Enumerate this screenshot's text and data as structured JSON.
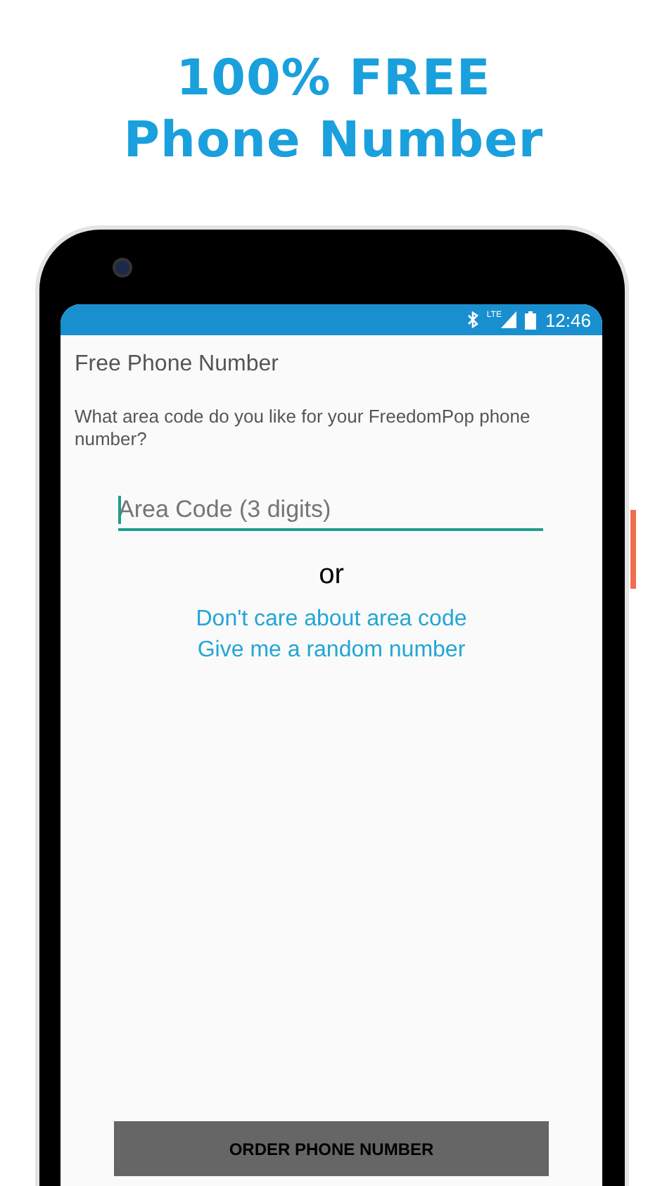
{
  "headline": [
    "100% FREE",
    "Phone Number"
  ],
  "status_bar": {
    "network": "LTE",
    "time": "12:46"
  },
  "screen": {
    "title": "Free Phone Number",
    "question": "What area code do you like for your FreedomPop phone number?",
    "area_code_field": {
      "placeholder": "Area Code (3 digits)",
      "focused": true
    },
    "separator": "or",
    "links": [
      "Don't care about area code",
      "Give me a random number"
    ],
    "button": "ORDER PHONE NUMBER"
  }
}
